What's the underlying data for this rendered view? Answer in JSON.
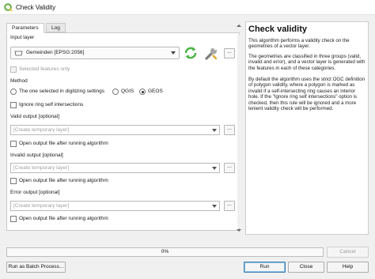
{
  "window": {
    "title": "Check Validity"
  },
  "tabs": [
    {
      "label": "Parameters",
      "active": true
    },
    {
      "label": "Log",
      "active": false
    }
  ],
  "params": {
    "input_layer_label": "Input layer",
    "input_layer_value": "Gemeinden [EPSG:2056]",
    "selected_features_label": "Selected features only",
    "method_label": "Method",
    "method_options": [
      {
        "label": "The one selected in digitizing settings",
        "selected": false
      },
      {
        "label": "QGIS",
        "selected": false
      },
      {
        "label": "GEOS",
        "selected": true
      }
    ],
    "ignore_ring_label": "Ignore ring self intersections",
    "valid_output_label": "Valid output [optional]",
    "invalid_output_label": "Invalid output [optional]",
    "error_output_label": "Error output [optional]",
    "temp_layer_placeholder": "[Create temporary layer]",
    "open_output_label": "Open output file after running algorithm",
    "browse_label": "..."
  },
  "help": {
    "title": "Check validity",
    "paragraphs": [
      "This algorithm performs a validity check on the geometries of a vector layer.",
      "The geometries are classified in three groups (valid, invalid and error), and a vector layer is generated with the features in each of these categories.",
      "By default the algorithm uses the strict OGC definition of polygon validity, where a polygon is marked as invalid if a self-intersecting ring causes an interior hole. If the \"Ignore ring self intersections\" option is checked, then this rule will be ignored and a more lenient validity check will be performed."
    ]
  },
  "progress": {
    "value": 0,
    "text": "0%"
  },
  "buttons": {
    "cancel": "Cancel",
    "batch": "Run as Batch Process...",
    "run": "Run",
    "close": "Close",
    "help": "Help"
  },
  "colors": {
    "accent": "#3a9bdc",
    "qgis_green": "#59a830",
    "iterate_green": "#4bb543"
  }
}
